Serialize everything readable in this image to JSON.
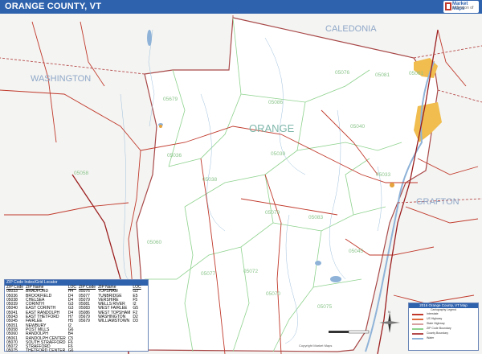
{
  "header": {
    "title": "ORANGE COUNTY, VT",
    "logo_line1": "Market Maps",
    "logo_line2": "a division of"
  },
  "map": {
    "county_label": "ORANGE",
    "neighbor_labels": [
      "CALEDONIA",
      "WASHINGTON",
      "GRAFTON"
    ],
    "highlight_color": "#f0bd4e",
    "water_color": "#8fb3d8",
    "road_color": "#c0392b",
    "zip_boundary_color": "#8ed28e",
    "zip_labels": [
      "05076",
      "05081",
      "05061",
      "05086",
      "05040",
      "05679",
      "05036",
      "05039",
      "05058",
      "05033",
      "05038",
      "05060",
      "05083",
      "05079",
      "05077",
      "05072",
      "05045",
      "05075",
      "05070"
    ]
  },
  "zip_locator": {
    "title": "ZIP Code Index/Grid Locator",
    "col1_headers": [
      "ZIP Code",
      "ZIP Name",
      "LOC"
    ],
    "col2_headers": [
      "ZIP Code",
      "ZIP Name",
      "LOC"
    ],
    "col1_rows": [
      [
        "05033",
        "BRADFORD",
        "H4"
      ],
      [
        "05036",
        "BROOKFIELD",
        "D4"
      ],
      [
        "05038",
        "CHELSEA",
        "D4"
      ],
      [
        "05039",
        "CORINTH",
        "G3"
      ],
      [
        "05040",
        "EAST CORINTH",
        "G3"
      ],
      [
        "05041",
        "EAST RANDOLPH",
        "D4"
      ],
      [
        "05043",
        "EAST THETFORD",
        "H7"
      ],
      [
        "05045",
        "FAIRLEE",
        "H5"
      ],
      [
        "05051",
        "NEWBURY",
        "I2"
      ],
      [
        "05058",
        "POST MILLS",
        "G6"
      ],
      [
        "05060",
        "RANDOLPH",
        "B4"
      ],
      [
        "05061",
        "RANDOLPH CENTER",
        "C5"
      ],
      [
        "05070",
        "SOUTH STRAFFORD",
        "F6"
      ],
      [
        "05072",
        "STRAFFORD",
        "F6"
      ],
      [
        "05075",
        "THETFORD CENTER",
        "G6"
      ]
    ],
    "col2_rows": [
      [
        "05076",
        "TOPSHAM",
        "G2"
      ],
      [
        "05077",
        "TUNBRIDGE",
        "E5"
      ],
      [
        "05079",
        "VERSHIRE",
        "F5"
      ],
      [
        "05081",
        "WELLS RIVER",
        "I2"
      ],
      [
        "05083",
        "WEST FAIRLEE",
        "G5"
      ],
      [
        "05086",
        "WEST TOPSHAM",
        "F2"
      ],
      [
        "05679",
        "WASHINGTON",
        "D2"
      ],
      [
        "05679",
        "WILLIAMSTOWN",
        "D3"
      ]
    ]
  },
  "legend": {
    "title": "2016 Orange County, VT Map",
    "subtitle": "Cartography Legend",
    "items": [
      {
        "label": "Interstate",
        "color": "#c0392b"
      },
      {
        "label": "US Highway",
        "color": "#e06a3c"
      },
      {
        "label": "State Highway",
        "color": "#d8a0a0"
      },
      {
        "label": "ZIP Code Boundary",
        "color": "#8ed28e"
      },
      {
        "label": "County Boundary",
        "color": "#b54b4b"
      },
      {
        "label": "Water",
        "color": "#8fb3d8"
      }
    ]
  },
  "compass": {
    "north": "N",
    "south": "S",
    "east": "E",
    "west": "W"
  },
  "footer": {
    "text": "Copyright Market Maps"
  }
}
